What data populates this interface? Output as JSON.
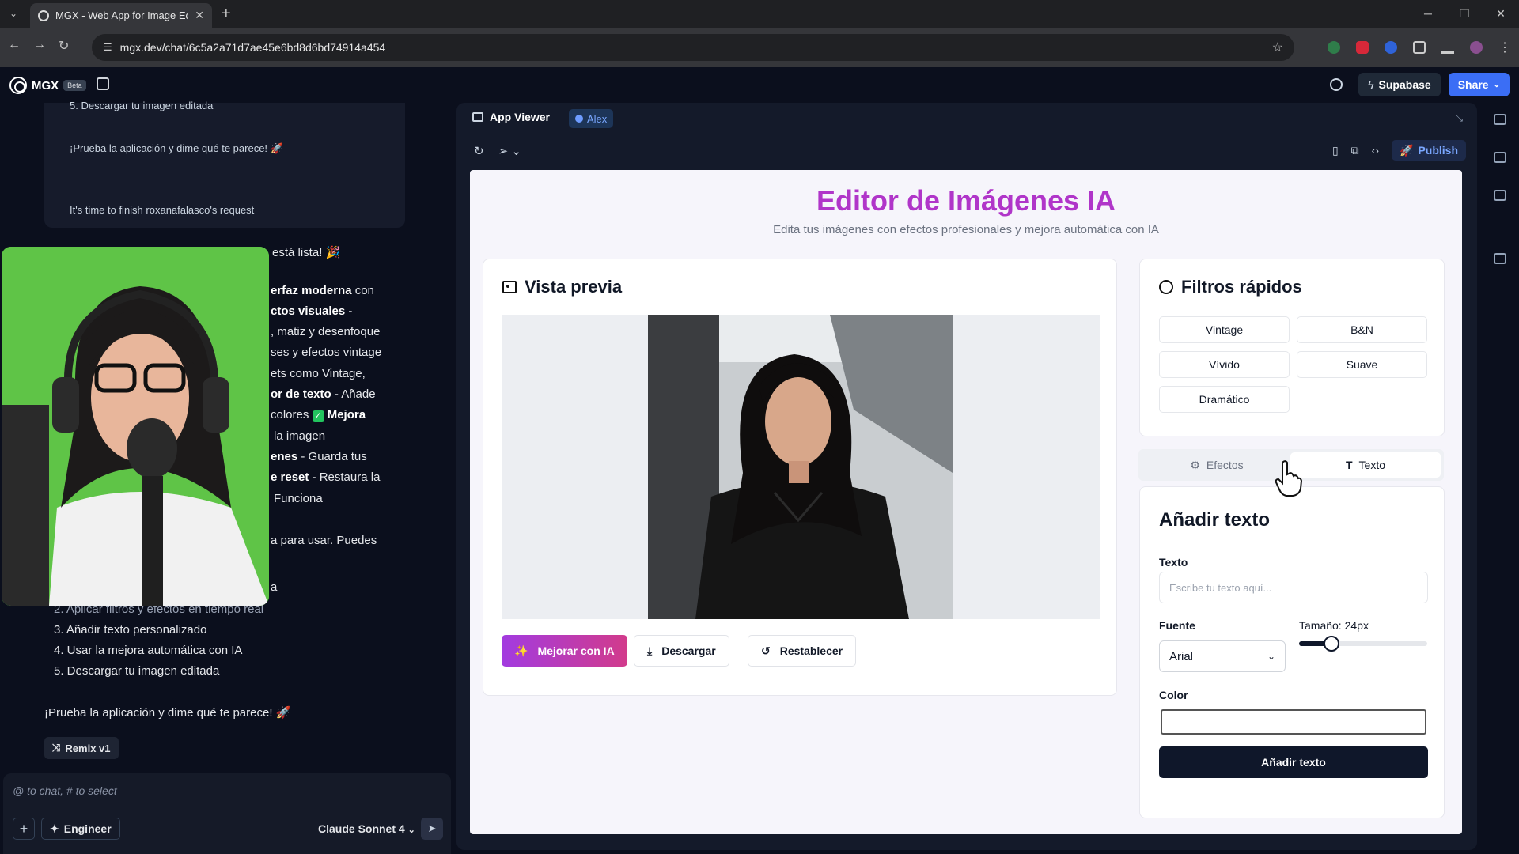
{
  "browser": {
    "tab_title": "MGX - Web App for Image Edit",
    "url": "mgx.dev/chat/6c5a2a71d7ae45e6bd8d6bd74914a454"
  },
  "header": {
    "logo": "MGX",
    "beta": "Beta",
    "supabase_label": "Supabase",
    "share_label": "Share"
  },
  "chat": {
    "card_lines": [
      "5. Descargar tu imagen editada",
      "¡Prueba la aplicación y dime qué te parece! 🚀",
      "It's time to finish roxanafalasco's request"
    ],
    "visible_fragments": [
      "está lista! 🎉",
      "erfaz moderna",
      "con",
      "ctos visuales",
      "-",
      ", matiz y desenfoque",
      "ses y efectos vintage",
      "ets como Vintage,",
      "or de texto",
      "- Añade",
      "colores",
      "Mejora",
      "la imagen",
      "enes",
      "- Guarda tus",
      "e reset",
      "- Restaura la",
      "Funciona",
      "a para usar. Puedes",
      "a"
    ],
    "steps": [
      "2. Aplicar filtros y efectos en tiempo real",
      "3. Añadir texto personalizado",
      "4. Usar la mejora automática con IA",
      "5. Descargar tu imagen editada"
    ],
    "closing": "¡Prueba la aplicación y dime qué te parece! 🚀",
    "remix_label": "Remix v1",
    "input_placeholder": "@ to chat, # to select",
    "engineer_label": "Engineer",
    "model_label": "Claude Sonnet 4"
  },
  "viewer": {
    "title": "App Viewer",
    "agent_badge": "Alex",
    "publish_label": "Publish"
  },
  "app": {
    "title": "Editor de Imágenes IA",
    "subtitle": "Edita tus imágenes con efectos profesionales y mejora automática con IA",
    "preview_title": "Vista previa",
    "enhance_label": "Mejorar con IA",
    "download_label": "Descargar",
    "reset_label": "Restablecer",
    "filters_title": "Filtros rápidos",
    "filters": [
      "Vintage",
      "B&N",
      "Vívido",
      "Suave",
      "Dramático"
    ],
    "tab_effects": "Efectos",
    "tab_text": "Texto",
    "text_panel_title": "Añadir texto",
    "text_label": "Texto",
    "text_placeholder": "Escribe tu texto aquí...",
    "font_label": "Fuente",
    "font_value": "Arial",
    "size_label": "Tamaño: 24px",
    "size_fraction": 0.25,
    "color_label": "Color",
    "add_text_button": "Añadir texto"
  },
  "colors": {
    "title_accent": "#b035c9",
    "primary_gradient_start": "#a23be0",
    "primary_gradient_end": "#d23b8b",
    "share_blue": "#3b6ef5",
    "dark_button": "#0f172a"
  }
}
